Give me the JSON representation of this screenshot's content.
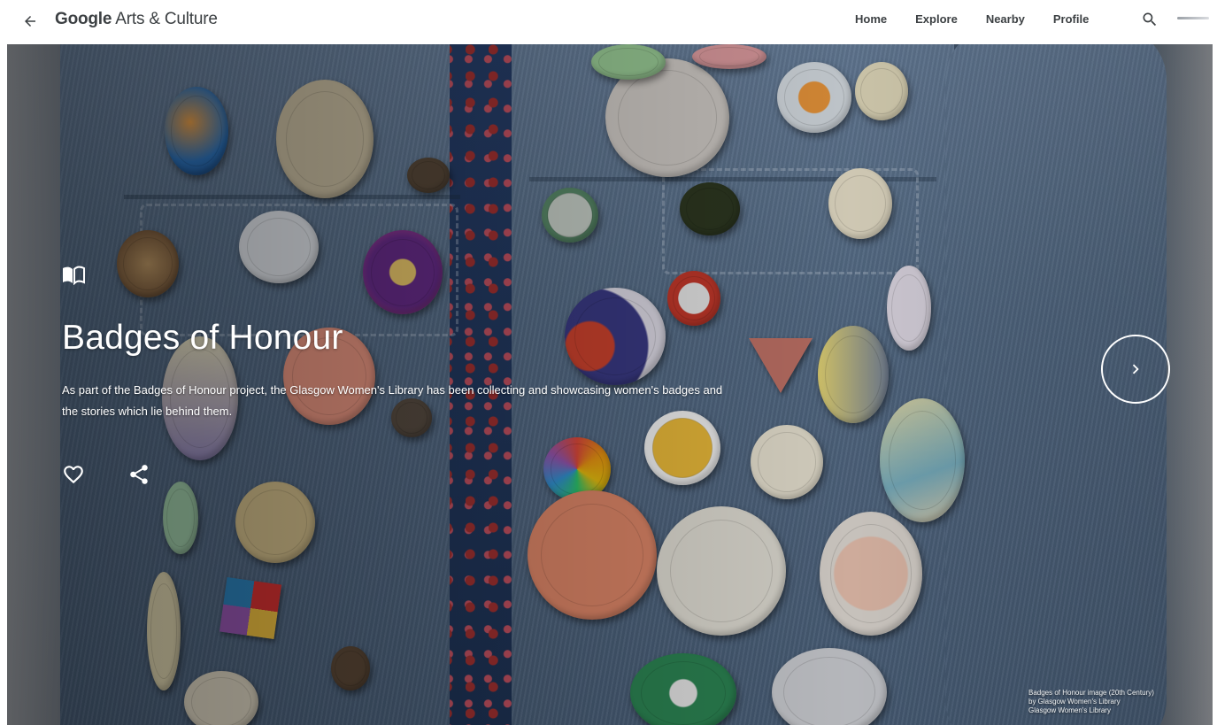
{
  "header": {
    "back_icon": "arrow-left-icon",
    "brand_google": "Google",
    "brand_rest": " Arts & Culture",
    "nav": [
      "Home",
      "Explore",
      "Nearby",
      "Profile"
    ],
    "search_icon": "search-icon"
  },
  "hero": {
    "story_icon": "open-book-icon",
    "title": "Badges of Honour",
    "description": "As part of the Badges of Honour project, the Glasgow Women's Library has been collecting and showcasing women's badges and the stories which lie behind them.",
    "like_icon": "heart-outline-icon",
    "share_icon": "share-icon",
    "next_icon": "chevron-right-icon",
    "credit": {
      "line1": "Badges of Honour image (20th Century)",
      "line2": "by Glasgow Women's Library",
      "line3": "Glasgow Women's Library"
    }
  },
  "colors": {
    "text_dark": "#3c4043",
    "hero_text": "#ffffff"
  }
}
